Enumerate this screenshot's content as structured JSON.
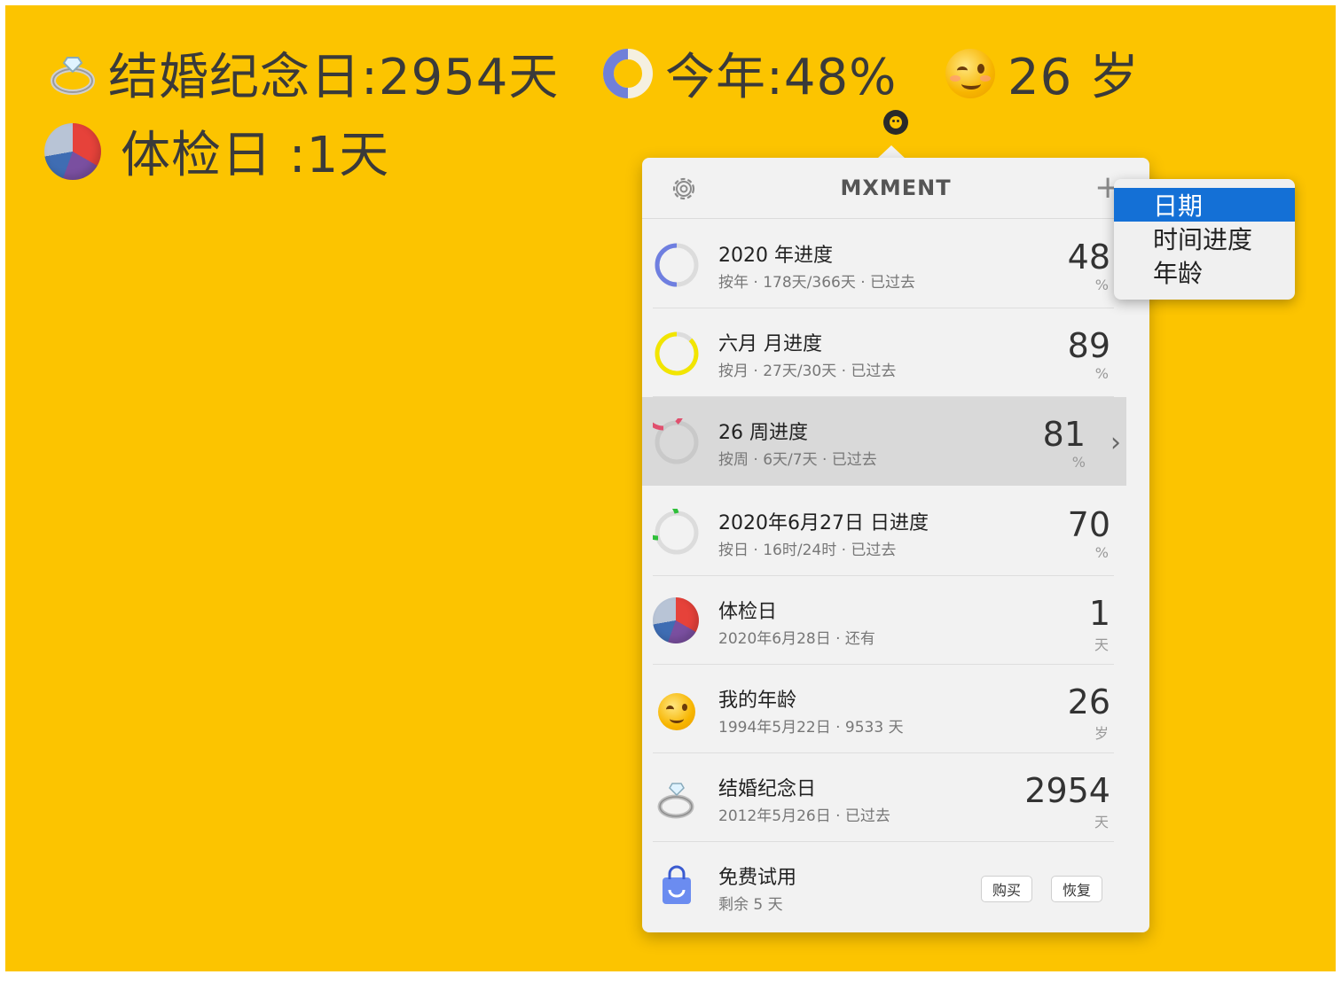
{
  "menubar": {
    "anniversary": "结婚纪念日:2954天",
    "year": "今年:48%",
    "age": "26 岁",
    "checkup": "体检日 :1天"
  },
  "popover": {
    "title": "MXMENT",
    "rows": [
      {
        "title": "2020 年进度",
        "sub": "按年 · 178天/366天 · 已过去",
        "value": "48",
        "unit": "%",
        "ring_color": "#6f7fe0",
        "progress": 0.48
      },
      {
        "title": "六月 月进度",
        "sub": "按月 · 27天/30天 · 已过去",
        "value": "89",
        "unit": "%",
        "ring_color": "#f2e500",
        "progress": 0.89
      },
      {
        "title": "26 周进度",
        "sub": "按周 · 6天/7天 · 已过去",
        "value": "81",
        "unit": "%",
        "ring_color": "#e0506e",
        "progress": 0.81
      },
      {
        "title": "2020年6月27日 日进度",
        "sub": "按日 · 16时/24时 · 已过去",
        "value": "70",
        "unit": "%",
        "ring_color": "#2fbf3a",
        "progress": 0.7
      },
      {
        "title": "体检日",
        "sub": "2020年6月28日 · 还有",
        "value": "1",
        "unit": "天"
      },
      {
        "title": "我的年龄",
        "sub": "1994年5月22日 · 9533 天",
        "value": "26",
        "unit": "岁"
      },
      {
        "title": "结婚纪念日",
        "sub": "2012年5月26日 · 已过去",
        "value": "2954",
        "unit": "天"
      },
      {
        "title": "免费试用",
        "sub": "剩余 5 天"
      }
    ],
    "buy_label": "购买",
    "restore_label": "恢复"
  },
  "add_menu": {
    "items": [
      "日期",
      "时间进度",
      "年龄"
    ],
    "selected": "日期"
  },
  "colors": {
    "desktop": "#fcc400",
    "accent": "#1470d6"
  }
}
